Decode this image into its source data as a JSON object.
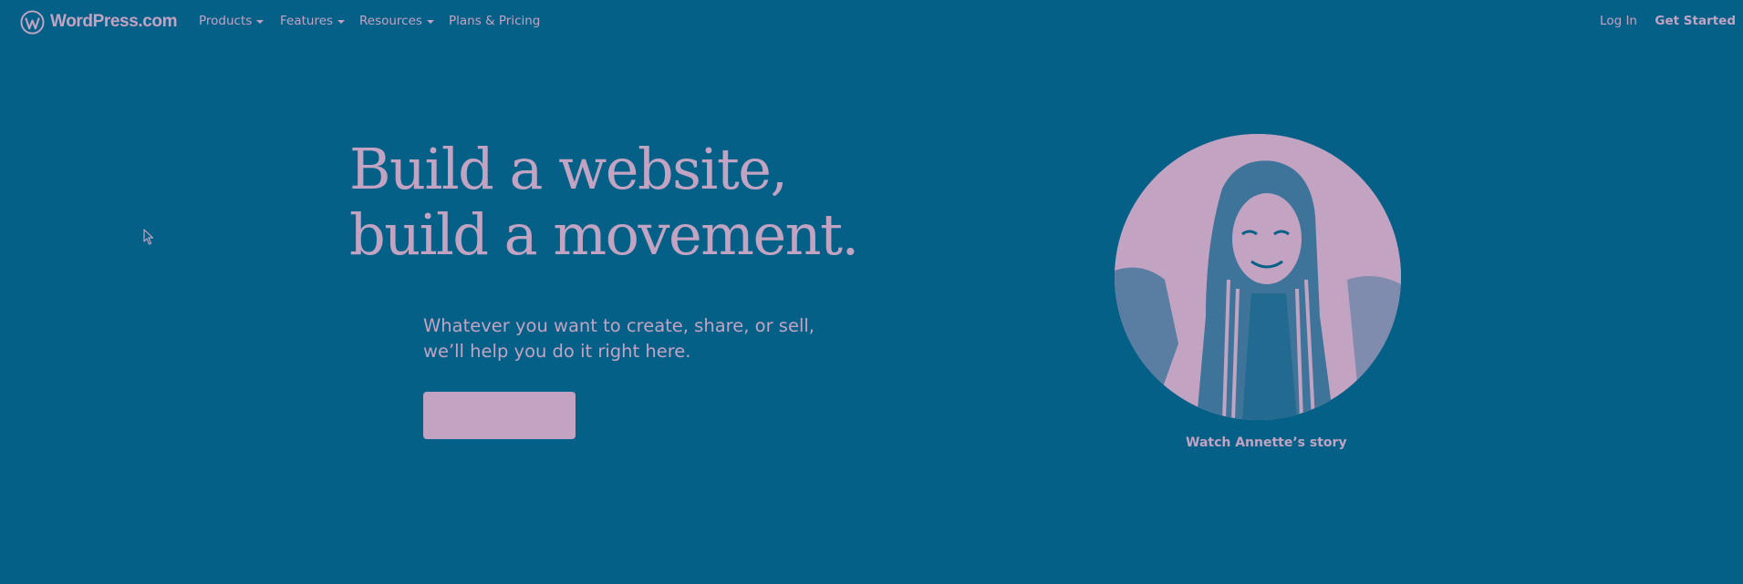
{
  "brand": {
    "name": "WordPress.com",
    "icon": "wordpress-logo-icon"
  },
  "nav": {
    "items": [
      {
        "label": "Products",
        "has_dropdown": true
      },
      {
        "label": "Features",
        "has_dropdown": true
      },
      {
        "label": "Resources",
        "has_dropdown": true
      },
      {
        "label": "Plans & Pricing",
        "has_dropdown": false
      }
    ],
    "login": "Log In",
    "get_started": "Get Started"
  },
  "hero": {
    "headline_line1": "Build a website,",
    "headline_line2": "build a movement.",
    "subtext_line1": "Whatever you want to create, share, or sell,",
    "subtext_line2": "we’ll help you do it right here.",
    "cta_label": ""
  },
  "story": {
    "caption": "Watch Annette’s story"
  },
  "colors": {
    "background": "#056088",
    "accent": "#c2a3c2"
  }
}
